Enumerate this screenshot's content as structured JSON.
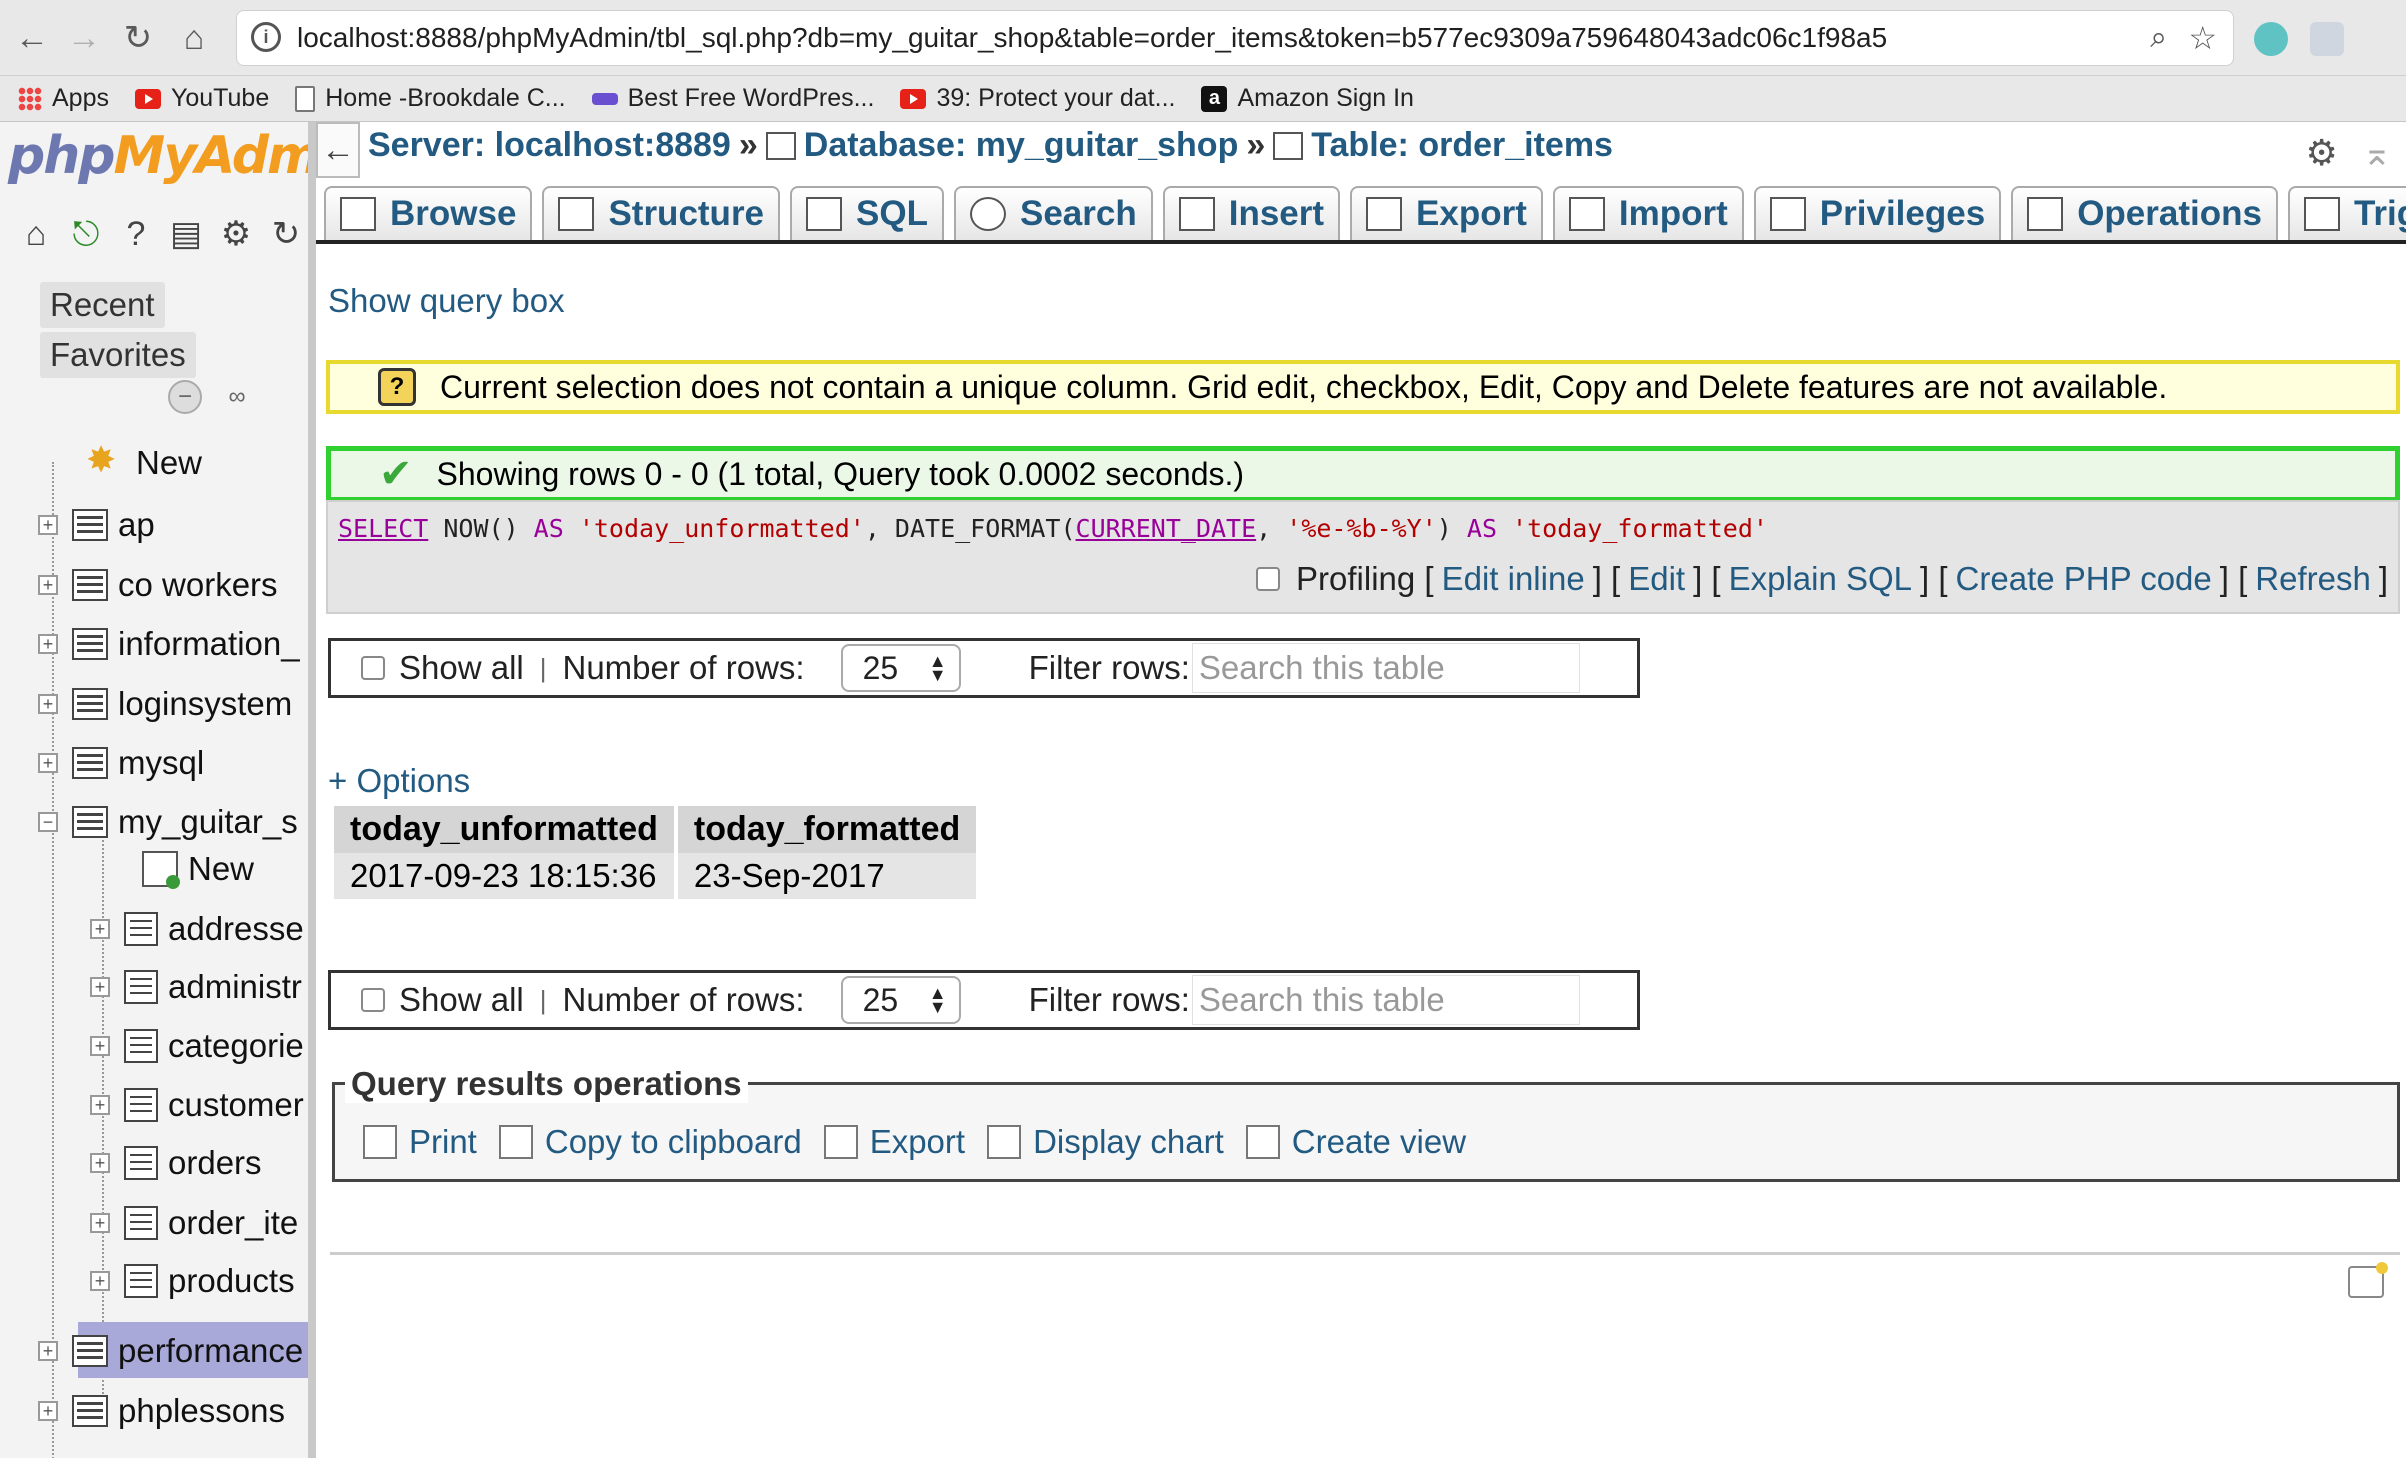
{
  "browser": {
    "url": "localhost:8888/phpMyAdmin/tbl_sql.php?db=my_guitar_shop&table=order_items&token=b577ec9309a759648043adc06c1f98a5",
    "bookmarks": [
      {
        "label": "Apps",
        "icon": "apps-grid-icon"
      },
      {
        "label": "YouTube",
        "icon": "youtube-icon"
      },
      {
        "label": "Home -Brookdale C...",
        "icon": "document-icon"
      },
      {
        "label": "Best Free WordPres...",
        "icon": "colorlib-icon"
      },
      {
        "label": "39: Protect your dat...",
        "icon": "youtube-icon"
      },
      {
        "label": "Amazon Sign In",
        "icon": "amazon-icon"
      }
    ]
  },
  "sidebar": {
    "logo_php": "php",
    "logo_my": "MyAdmi",
    "recent_label": "Recent",
    "favorites_label": "Favorites",
    "new_label": "New",
    "databases": [
      {
        "name": "ap"
      },
      {
        "name": "co workers"
      },
      {
        "name": "information_"
      },
      {
        "name": "loginsystem"
      },
      {
        "name": "mysql"
      },
      {
        "name": "my_guitar_s"
      },
      {
        "name": "performance"
      },
      {
        "name": "phplessons"
      }
    ],
    "tables": {
      "new_label": "New",
      "items": [
        "addresse",
        "administr",
        "categorie",
        "customer",
        "orders",
        "order_ite",
        "products"
      ],
      "selected": "order_ite"
    }
  },
  "breadcrumb": {
    "server": "Server: localhost:8889",
    "database": "Database: my_guitar_shop",
    "table": "Table: order_items",
    "separator": "»"
  },
  "tabs": [
    "Browse",
    "Structure",
    "SQL",
    "Search",
    "Insert",
    "Export",
    "Import",
    "Privileges",
    "Operations",
    "Triggers"
  ],
  "main": {
    "show_query_box": "Show query box",
    "notice": "Current selection does not contain a unique column. Grid edit, checkbox, Edit, Copy and Delete features are not available.",
    "success": "Showing rows 0 - 0 (1 total, Query took 0.0002 seconds.)",
    "sql": {
      "t1": "SELECT",
      "t2": " NOW() ",
      "t3": "AS",
      "t4": " 'today_unformatted'",
      "t5": ", DATE_FORMAT(",
      "t6": "CURRENT_DATE",
      "t7": ", ",
      "t8": "'%e-%b-%Y'",
      "t9": ") ",
      "t10": "AS",
      "t11": " 'today_formatted'"
    },
    "sql_actions": {
      "profiling": "Profiling",
      "edit_inline": "Edit inline",
      "edit": "Edit",
      "explain_sql": "Explain SQL",
      "create_php_code": "Create PHP code",
      "refresh": "Refresh"
    },
    "nav": {
      "show_all": "Show all",
      "number_of_rows_label": "Number of rows:",
      "number_of_rows_value": "25",
      "filter_label": "Filter rows:",
      "filter_placeholder": "Search this table"
    },
    "options_link": "+ Options",
    "results": {
      "columns": [
        "today_unformatted",
        "today_formatted"
      ],
      "rows": [
        [
          "2017-09-23 18:15:36",
          "23-Sep-2017"
        ]
      ]
    },
    "query_results_operations": {
      "legend": "Query results operations",
      "links": [
        "Print",
        "Copy to clipboard",
        "Export",
        "Display chart",
        "Create view"
      ]
    }
  }
}
